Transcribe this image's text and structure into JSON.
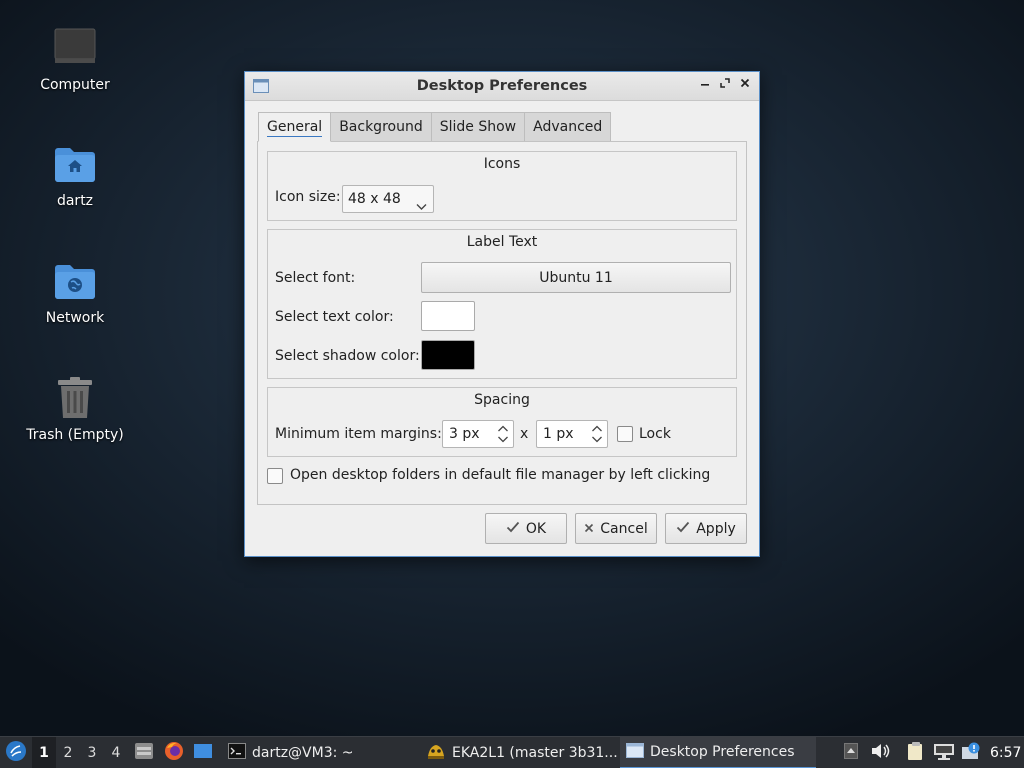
{
  "desktop": {
    "icons": [
      {
        "label": "Computer"
      },
      {
        "label": "dartz"
      },
      {
        "label": "Network"
      },
      {
        "label": "Trash (Empty)"
      }
    ]
  },
  "dialog": {
    "title": "Desktop Preferences",
    "tabs": [
      {
        "label": "General",
        "active": true
      },
      {
        "label": "Background"
      },
      {
        "label": "Slide Show"
      },
      {
        "label": "Advanced"
      }
    ],
    "icons_group": {
      "title": "Icons",
      "icon_size_label": "Icon size:",
      "icon_size_value": "48 x 48"
    },
    "label_text_group": {
      "title": "Label Text",
      "font_label": "Select font:",
      "font_value": "Ubuntu 11",
      "text_color_label": "Select text color:",
      "text_color": "#ffffff",
      "shadow_color_label": "Select shadow color:",
      "shadow_color": "#000000"
    },
    "spacing_group": {
      "title": "Spacing",
      "margins_label": "Minimum item margins:",
      "margin_x": "3 px",
      "separator": "x",
      "margin_y": "1 px",
      "lock_label": "Lock",
      "lock_checked": false
    },
    "open_folders_label": "Open desktop folders in default file manager by left clicking",
    "open_folders_checked": false,
    "buttons": {
      "ok": "OK",
      "cancel": "Cancel",
      "apply": "Apply"
    }
  },
  "taskbar": {
    "workspaces": [
      "1",
      "2",
      "3",
      "4"
    ],
    "active_workspace": "1",
    "tasks": [
      {
        "label": "dartz@VM3: ~"
      },
      {
        "label": "EKA2L1 (master 3b31..."
      },
      {
        "label": "Desktop Preferences",
        "active": true
      }
    ],
    "clock": "6:57"
  },
  "colors": {
    "accent": "#3a78c2",
    "folder_blue": "#4a90d9"
  }
}
